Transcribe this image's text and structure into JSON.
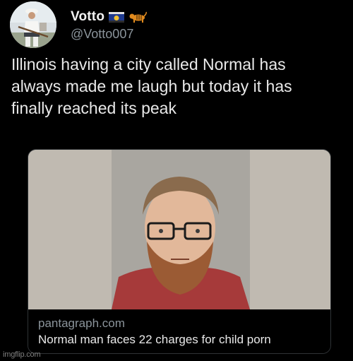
{
  "author": {
    "display_name": "Votto",
    "handle": "@Votto007",
    "badges": [
      "flag-icon",
      "tiger-icon"
    ]
  },
  "tweet": {
    "text": "Illinois having a city called Normal has\nalways made me laugh but today it has\nfinally reached its peak"
  },
  "link_card": {
    "domain": "pantagraph.com",
    "title": "Normal man faces 22 charges for child porn"
  },
  "watermark": "imgflip.com",
  "colors": {
    "background": "#000000",
    "text": "#e7e9ea",
    "secondary_text": "#8b949b",
    "card_border": "#2f3336"
  }
}
